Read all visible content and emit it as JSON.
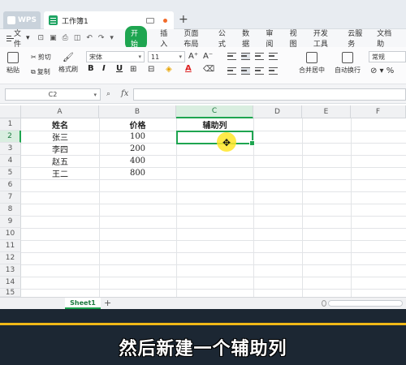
{
  "tabs": {
    "wps_label": "WPS",
    "doc_label": "工作簿1",
    "add_label": "+"
  },
  "menu": {
    "file_label": "文件",
    "items": [
      "开始",
      "插入",
      "页面布局",
      "公式",
      "数据",
      "审阅",
      "视图",
      "开发工具",
      "云服务",
      "文档助"
    ]
  },
  "ribbon": {
    "cut_label": "剪切",
    "copy_label": "复制",
    "format_painter_label": "格式刷",
    "paste_label": "粘贴",
    "font_name": "宋体",
    "font_size": "11",
    "merge_label": "合并居中",
    "wrap_label": "自动换行",
    "number_format": "常规",
    "bold": "B",
    "italic": "I",
    "underline": "U",
    "grow_font": "A⁺",
    "shrink_font": "A⁻",
    "font_color": "A"
  },
  "formula_bar": {
    "cell_ref": "C2",
    "fx_label": "fx",
    "value": ""
  },
  "sheet": {
    "columns": [
      "A",
      "B",
      "C",
      "D",
      "E",
      "F"
    ],
    "rows": [
      "1",
      "2",
      "3",
      "4",
      "5",
      "6",
      "7",
      "8",
      "9",
      "10",
      "11",
      "12",
      "13",
      "14",
      "15"
    ],
    "selected_column": "C",
    "selected_row": "2",
    "cells": {
      "A1": "姓名",
      "B1": "价格",
      "C1": "辅助列",
      "A2": "张三",
      "B2": "100",
      "A3": "李四",
      "B3": "200",
      "A4": "赵五",
      "B4": "400",
      "A5": "王二",
      "B5": "800"
    }
  },
  "sheet_tabs": {
    "active": "Sheet1",
    "add_label": "+"
  },
  "caption": "然后新建一个辅助列",
  "colors": {
    "accent_green": "#1ea550",
    "caption_band": "#1c2733",
    "caption_line": "#f0b817",
    "cursor_highlight": "#ffe628"
  }
}
